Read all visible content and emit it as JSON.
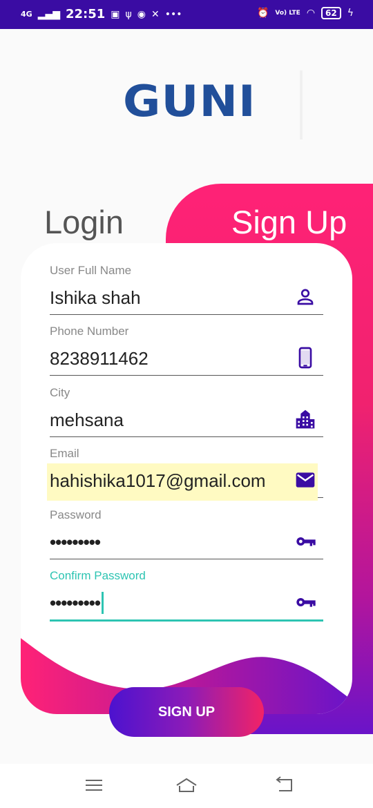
{
  "status_bar": {
    "network": "4G",
    "time": "22:51",
    "volte": "Vo) LTE",
    "battery": "62"
  },
  "logo": "GUNI",
  "tabs": {
    "login": "Login",
    "signup": "Sign Up"
  },
  "form": {
    "full_name": {
      "label": "User Full Name",
      "value": "Ishika shah",
      "icon": "person-icon"
    },
    "phone": {
      "label": "Phone Number",
      "value": "8238911462",
      "icon": "phone-icon"
    },
    "city": {
      "label": "City",
      "value": "mehsana",
      "icon": "city-icon"
    },
    "email": {
      "label": "Email",
      "value": "hahishika1017@gmail.com",
      "icon": "mail-icon"
    },
    "password": {
      "label": "Password",
      "value": "•••••••••",
      "icon": "key-icon"
    },
    "confirm_password": {
      "label": "Confirm Password",
      "value": "•••••••••",
      "icon": "key-icon"
    }
  },
  "signup_button": "SIGN UP",
  "colors": {
    "statusbar": "#3a0ca3",
    "accent": "#2dc4b2",
    "icon": "#3a0ca3",
    "pink": "#ff2276",
    "purple": "#6a14c9"
  }
}
